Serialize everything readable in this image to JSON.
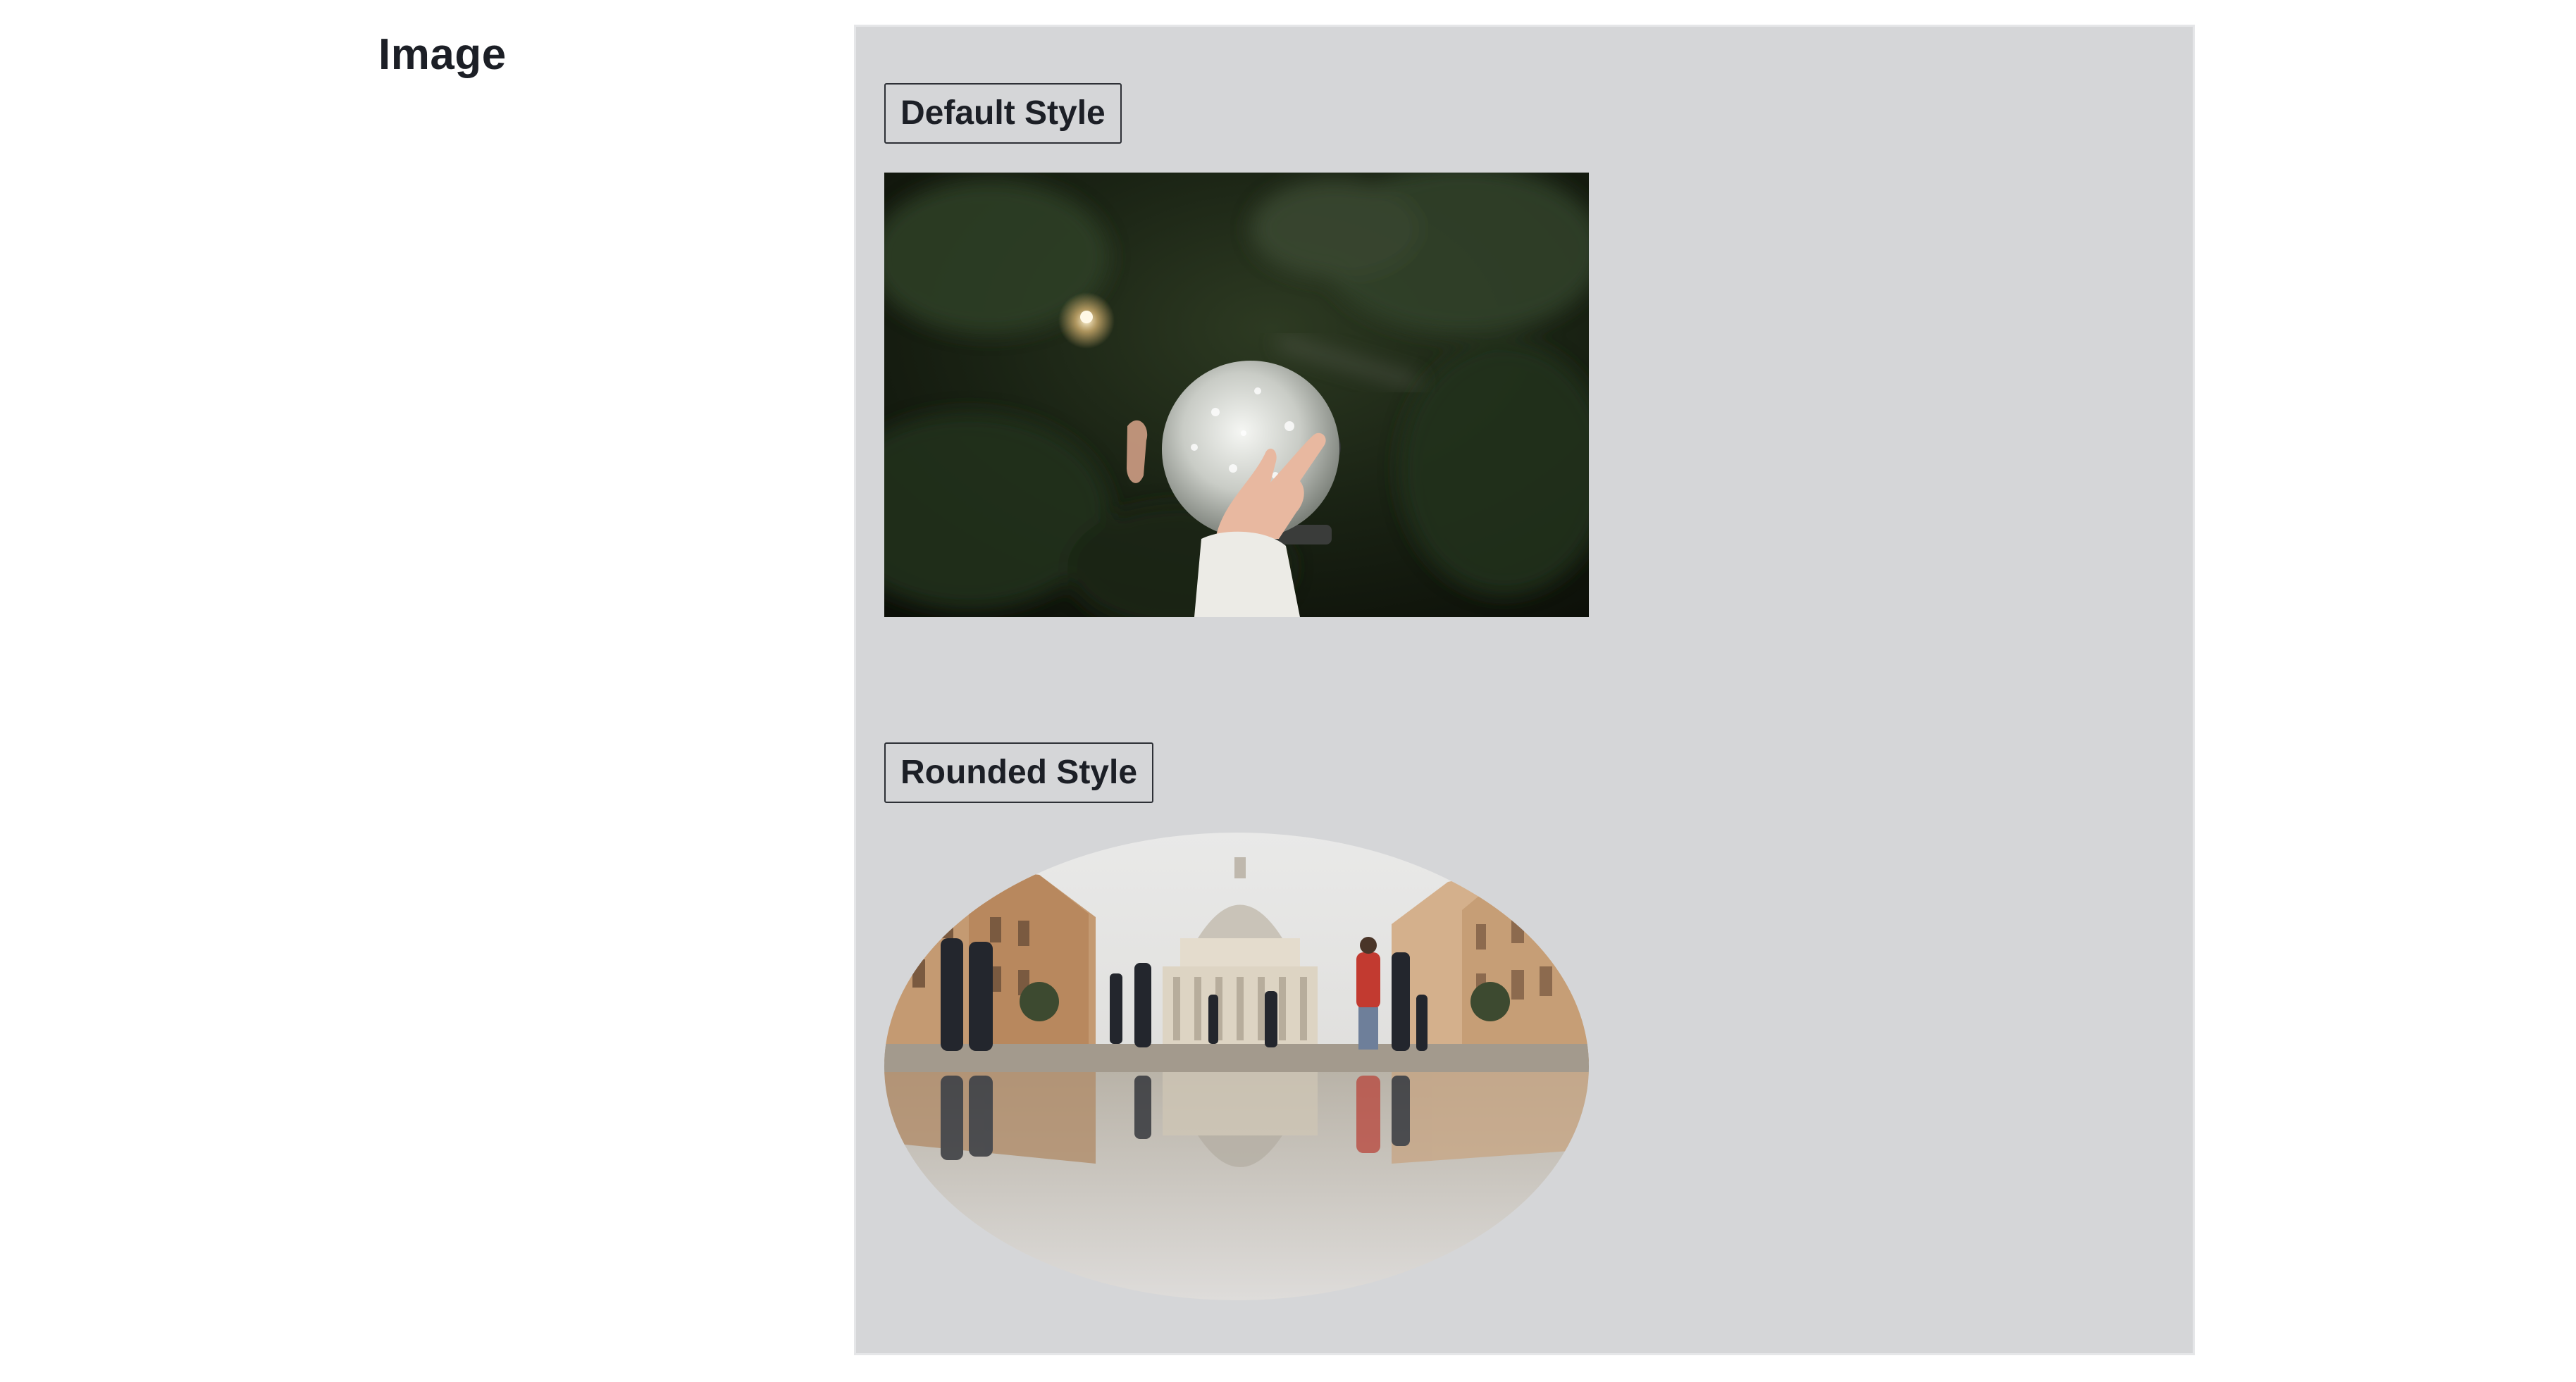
{
  "page": {
    "title": "Image"
  },
  "sections": [
    {
      "label": "Default Style",
      "image": "christmas-snow-globe-photo"
    },
    {
      "label": "Rounded Style",
      "image": "st-peters-basilica-reflection-photo"
    }
  ],
  "colors": {
    "panel_background": "#d5d6d8",
    "text": "#1c1f26",
    "label_border": "#2d3036"
  }
}
